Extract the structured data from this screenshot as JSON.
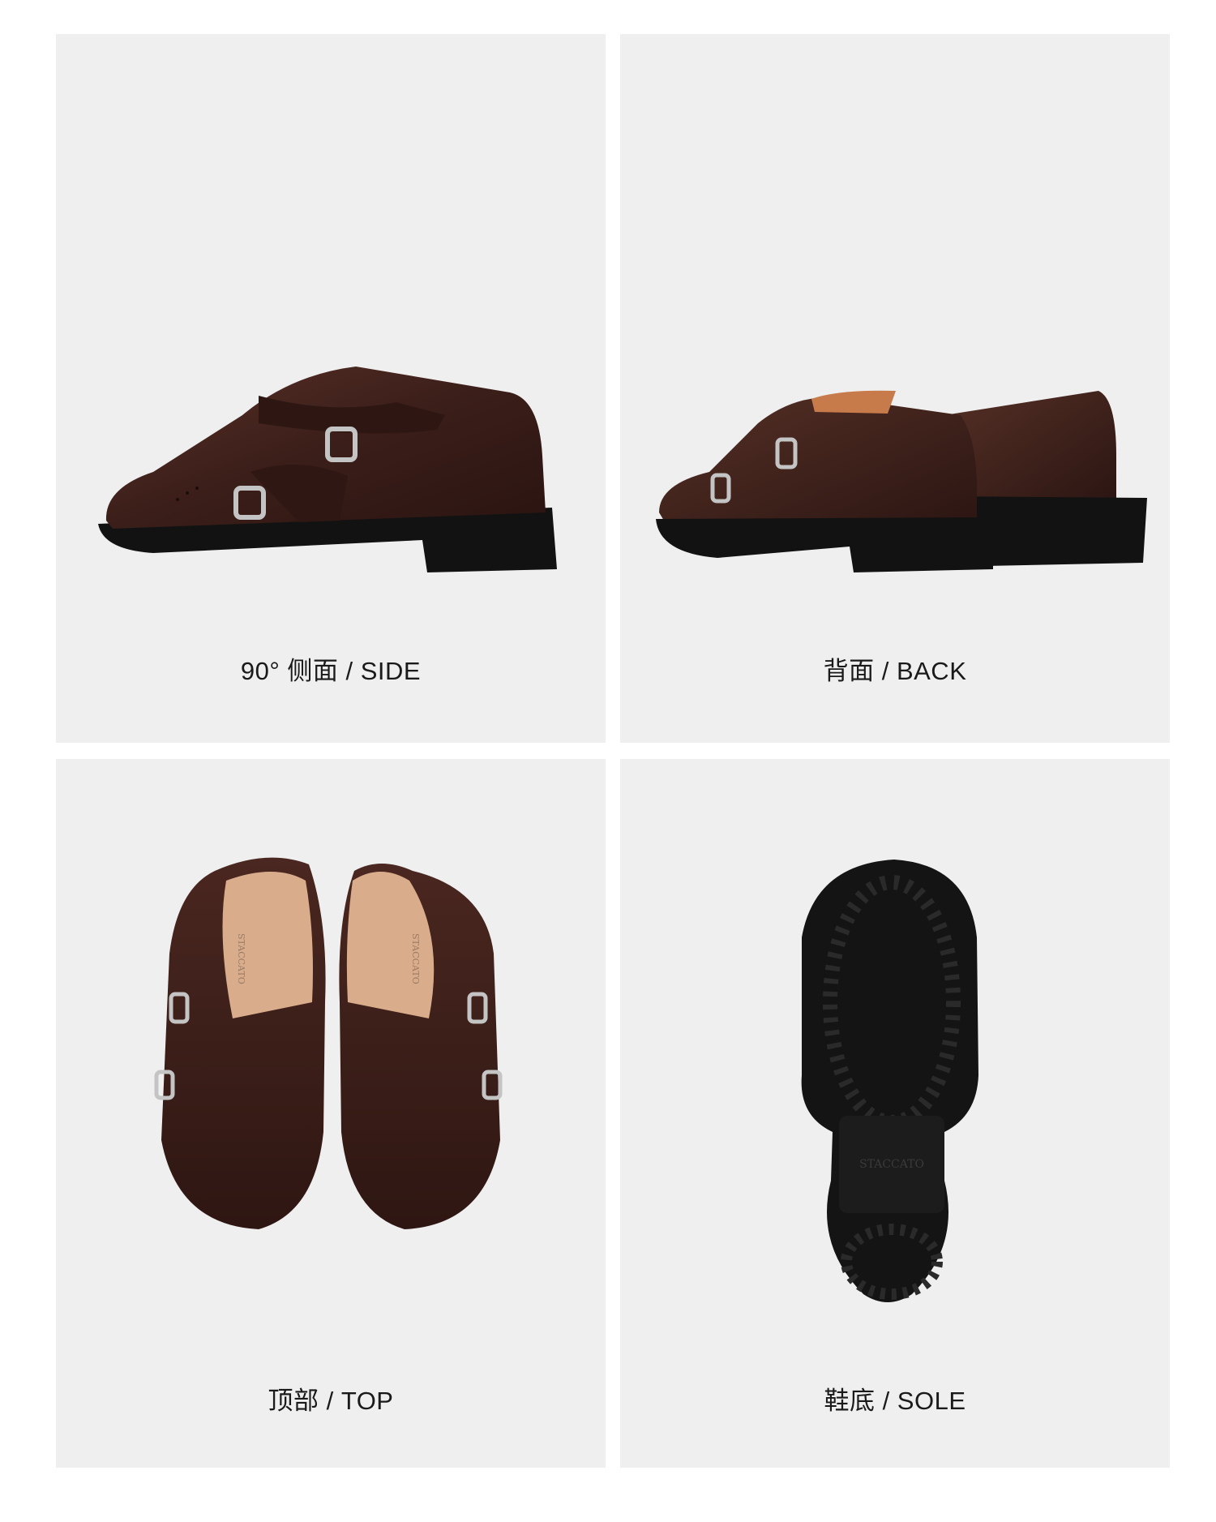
{
  "panels": [
    {
      "caption": "90° 侧面 / SIDE"
    },
    {
      "caption": "背面 / BACK"
    },
    {
      "caption": "顶部 / TOP"
    },
    {
      "caption": "鞋底 / SOLE"
    }
  ],
  "brand": {
    "insole_text": "STACCATO",
    "sole_text": "STACCATO"
  },
  "colors": {
    "panel_bg": "#efefef",
    "leather": "#3a1f1a",
    "sole": "#111111",
    "insole": "#d9ac8c",
    "buckle": "#b9b9b9"
  }
}
